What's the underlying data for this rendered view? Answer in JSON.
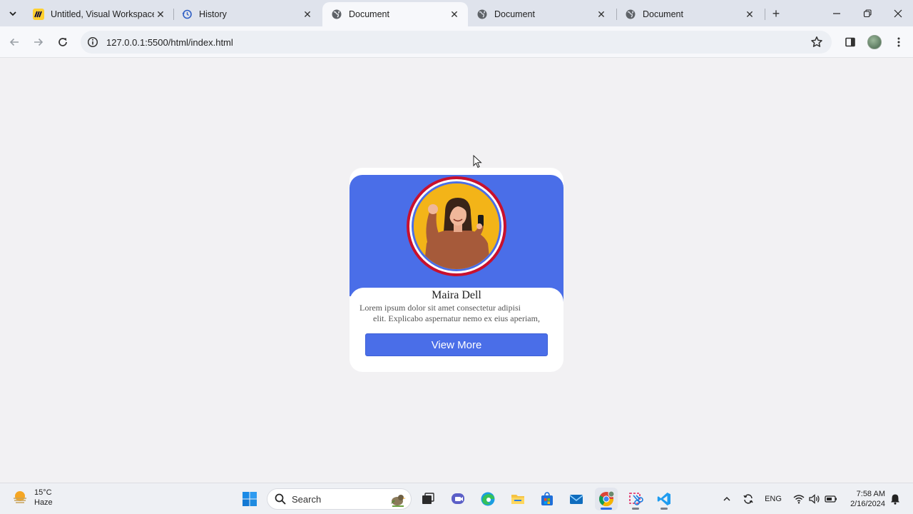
{
  "browser": {
    "tabs": [
      {
        "title": "Untitled, Visual Workspace f",
        "icon": "miro-icon",
        "active": false
      },
      {
        "title": "History",
        "icon": "history-icon",
        "active": false
      },
      {
        "title": "Document",
        "icon": "globe-icon",
        "active": true
      },
      {
        "title": "Document",
        "icon": "globe-icon",
        "active": false
      },
      {
        "title": "Document",
        "icon": "globe-icon",
        "active": false
      }
    ],
    "url": "127.0.0.1:5500/html/index.html"
  },
  "card": {
    "name": "Maira Dell",
    "description_line1": "Lorem ipsum dolor sit amet consectetur adipisi",
    "description_line2": "elit. Explicabo aspernatur nemo ex eius aperiam,",
    "button_label": "View More",
    "accent_color": "#4a6ee8",
    "ring_color": "#c8102e"
  },
  "taskbar": {
    "weather_temp": "15°C",
    "weather_desc": "Haze",
    "search_placeholder": "Search",
    "language": "ENG",
    "time": "7:58 AM",
    "date": "2/16/2024"
  }
}
